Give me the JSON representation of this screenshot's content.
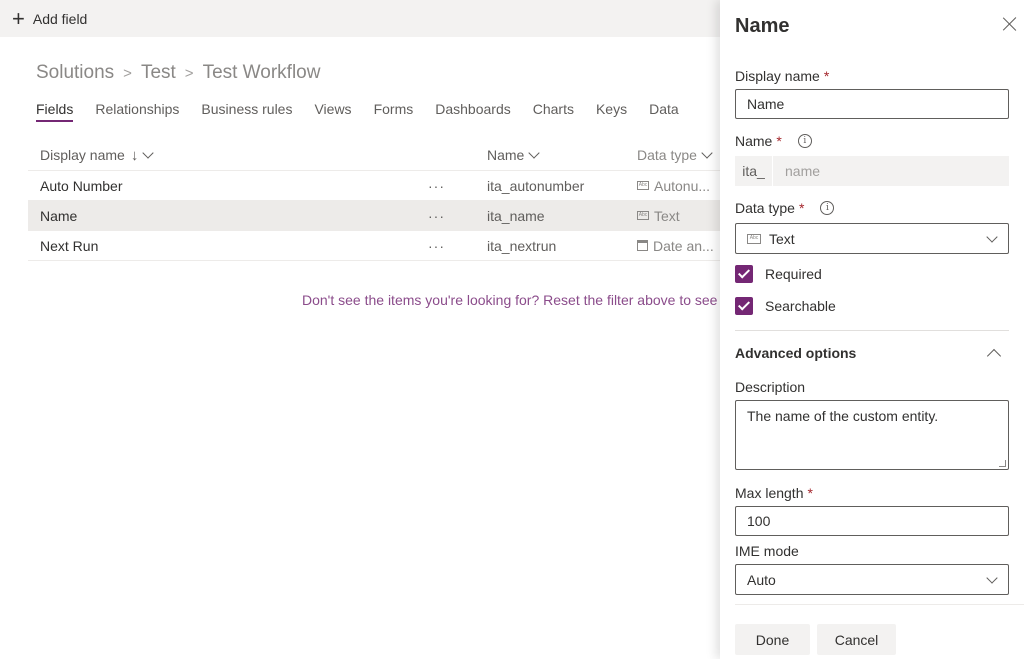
{
  "command_bar": {
    "add_field_label": "Add field"
  },
  "breadcrumb": [
    "Solutions",
    "Test",
    "Test Workflow"
  ],
  "tabs": [
    "Fields",
    "Relationships",
    "Business rules",
    "Views",
    "Forms",
    "Dashboards",
    "Charts",
    "Keys",
    "Data"
  ],
  "active_tab": "Fields",
  "grid": {
    "columns": {
      "display_name": "Display name",
      "name": "Name",
      "data_type": "Data type"
    },
    "rows": [
      {
        "display_name": "Auto Number",
        "more": "···",
        "name": "ita_autonumber",
        "data_type": "Autonu...",
        "icon": "text-field-icon"
      },
      {
        "display_name": "Name",
        "more": "···",
        "name": "ita_name",
        "data_type": "Text",
        "icon": "text-field-icon"
      },
      {
        "display_name": "Next Run",
        "more": "···",
        "name": "ita_nextrun",
        "data_type": "Date an...",
        "icon": "calendar-icon"
      }
    ],
    "selected_row": 1
  },
  "empty_message": "Don't see the items you're looking for? Reset the filter above to see more",
  "pane": {
    "title": "Name",
    "display_name": {
      "label": "Display name",
      "required": "*",
      "value": "Name"
    },
    "name_field": {
      "label": "Name",
      "required": "*",
      "prefix": "ita_",
      "placeholder": "name"
    },
    "data_type": {
      "label": "Data type",
      "required": "*",
      "value": "Text",
      "type_icon_text": "Abc"
    },
    "required_label": "Required",
    "searchable_label": "Searchable",
    "advanced_options": "Advanced options",
    "description": {
      "label": "Description",
      "value": "The name of the custom entity."
    },
    "max_length": {
      "label": "Max length",
      "required": "*",
      "value": "100"
    },
    "ime_mode": {
      "label": "IME mode",
      "value": "Auto"
    },
    "done_label": "Done",
    "cancel_label": "Cancel",
    "info_glyph": "i"
  },
  "colors": {
    "accent": "#742774",
    "link": "#8b4c8b",
    "required": "#a4262c"
  }
}
